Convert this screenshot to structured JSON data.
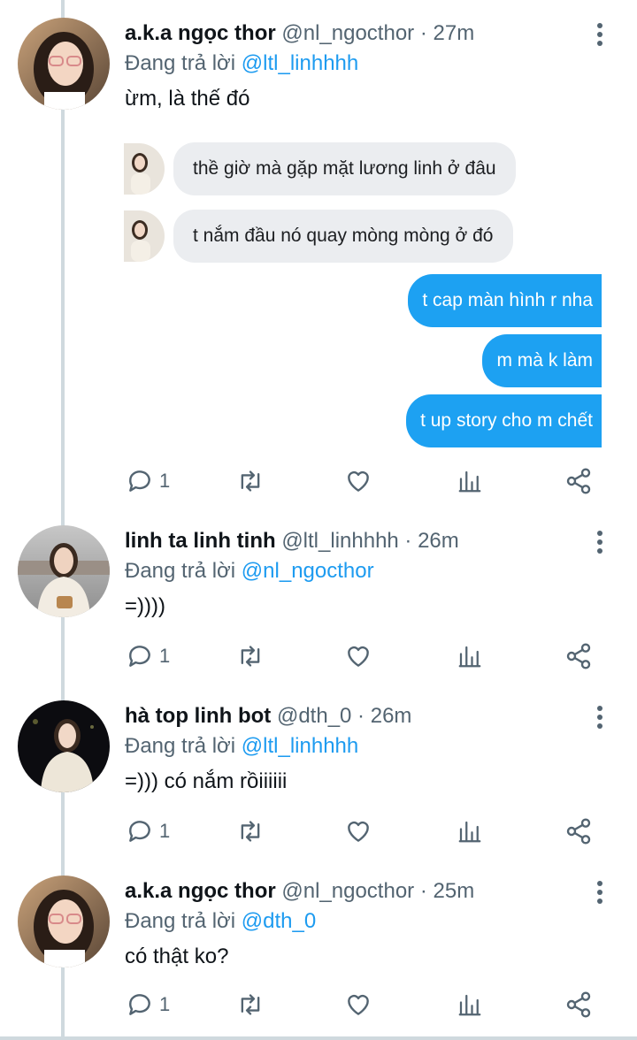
{
  "colors": {
    "accent": "#1d9bf0",
    "muted": "#536471",
    "thread_line": "#cfd9de",
    "bubble_out": "#1da1f2",
    "bubble_in": "#ebedf0"
  },
  "tweets": [
    {
      "name": "a.k.a ngọc thor",
      "handle": "@nl_ngocthor · 27m",
      "reply_prefix": "Đang trả lời",
      "reply_to": "@ltl_linhhhh",
      "text": "ừm, là thế đó",
      "reply_count": "1",
      "chat": {
        "incoming": [
          "thề giờ mà gặp mặt lương linh ở đâu",
          "t nắm đầu nó quay mòng mòng ở đó"
        ],
        "outgoing": [
          "t cap màn hình r nha",
          "m mà k làm",
          "t up story cho m chết"
        ]
      }
    },
    {
      "name": "linh ta linh tinh",
      "handle": "@ltl_linhhhh · 26m",
      "reply_prefix": "Đang trả lời",
      "reply_to": "@nl_ngocthor",
      "text": "=))))",
      "reply_count": "1"
    },
    {
      "name": "hà top linh bot",
      "handle": "@dth_0 · 26m",
      "reply_prefix": "Đang trả lời",
      "reply_to": "@ltl_linhhhh",
      "text": "=))) có nắm rồiiiiii",
      "reply_count": "1"
    },
    {
      "name": "a.k.a ngọc thor",
      "handle": "@nl_ngocthor · 25m",
      "reply_prefix": "Đang trả lời",
      "reply_to": "@dth_0",
      "text": "có thật ko?",
      "reply_count": "1"
    }
  ],
  "icons": [
    "reply-icon",
    "retweet-icon",
    "like-icon",
    "analytics-icon",
    "share-icon",
    "more-icon"
  ]
}
